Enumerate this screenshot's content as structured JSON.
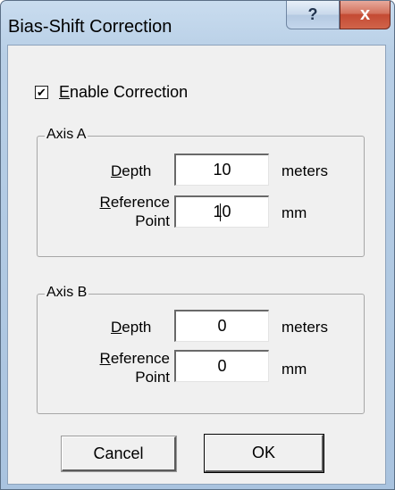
{
  "window": {
    "title": "Bias-Shift Correction",
    "help_glyph": "?",
    "close_glyph": "x"
  },
  "enable": {
    "label": "Enable Correction",
    "mnemonic": "E",
    "rest": "nable Correction",
    "checked": true,
    "check_glyph": "✔"
  },
  "axis_a": {
    "legend": "Axis A",
    "depth": {
      "label_mnemonic": "D",
      "label_rest": "epth",
      "value": "10",
      "unit": "meters"
    },
    "reference": {
      "label_line1_mnemonic": "R",
      "label_line1_rest": "eference",
      "label_line2": "Point",
      "value": "10",
      "unit": "mm"
    }
  },
  "axis_b": {
    "legend": "Axis B",
    "depth": {
      "label_mnemonic": "D",
      "label_rest": "epth",
      "value": "0",
      "unit": "meters"
    },
    "reference": {
      "label_line1_mnemonic": "R",
      "label_line1_rest": "eference",
      "label_line2": "Point",
      "value": "0",
      "unit": "mm"
    }
  },
  "buttons": {
    "cancel": "Cancel",
    "ok": "OK"
  },
  "icons": {
    "help": "help-icon",
    "close": "close-icon",
    "check": "checkmark-icon"
  }
}
